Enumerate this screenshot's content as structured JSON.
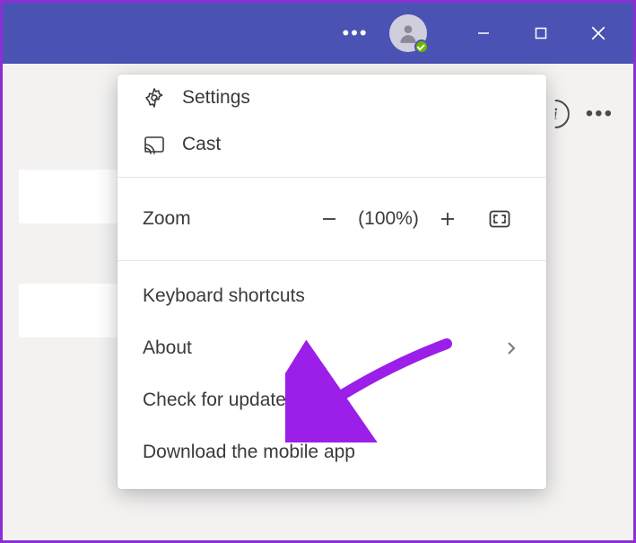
{
  "menu": {
    "settings": "Settings",
    "cast": "Cast",
    "zoom_label": "Zoom",
    "zoom_value": "(100%)",
    "keyboard": "Keyboard shortcuts",
    "about": "About",
    "check_updates": "Check for updates",
    "download_app": "Download the mobile app"
  }
}
